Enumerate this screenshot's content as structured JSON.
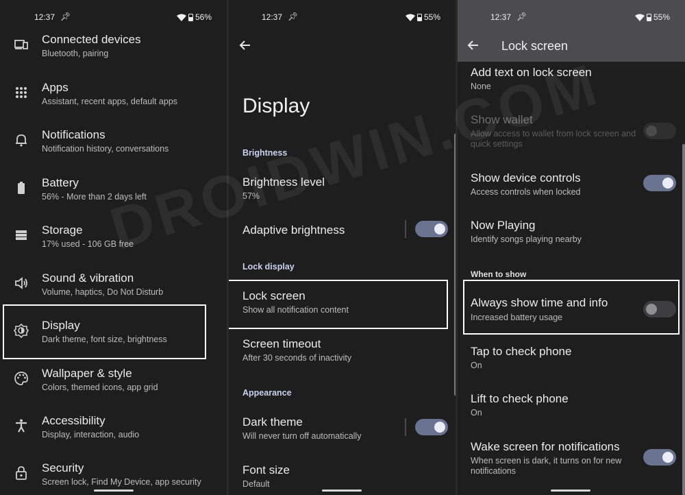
{
  "status": [
    {
      "time": "12:37",
      "battery": "56%"
    },
    {
      "time": "12:37",
      "battery": "55%"
    },
    {
      "time": "12:37",
      "battery": "55%"
    }
  ],
  "settings": {
    "items": [
      {
        "title": "Connected devices",
        "sub": "Bluetooth, pairing",
        "icon": "devices-icon"
      },
      {
        "title": "Apps",
        "sub": "Assistant, recent apps, default apps",
        "icon": "apps-grid-icon"
      },
      {
        "title": "Notifications",
        "sub": "Notification history, conversations",
        "icon": "bell-icon"
      },
      {
        "title": "Battery",
        "sub": "56% - More than 2 days left",
        "icon": "battery-icon"
      },
      {
        "title": "Storage",
        "sub": "17% used - 106 GB free",
        "icon": "storage-icon"
      },
      {
        "title": "Sound & vibration",
        "sub": "Volume, haptics, Do Not Disturb",
        "icon": "speaker-icon"
      },
      {
        "title": "Display",
        "sub": "Dark theme, font size, brightness",
        "icon": "display-brightness-icon"
      },
      {
        "title": "Wallpaper & style",
        "sub": "Colors, themed icons, app grid",
        "icon": "palette-icon"
      },
      {
        "title": "Accessibility",
        "sub": "Display, interaction, audio",
        "icon": "accessibility-icon"
      },
      {
        "title": "Security",
        "sub": "Screen lock, Find My Device, app security",
        "icon": "lock-icon"
      }
    ]
  },
  "display": {
    "page_title": "Display",
    "sections": {
      "brightness": "Brightness",
      "lock_display": "Lock display",
      "appearance": "Appearance"
    },
    "brightness_level": {
      "title": "Brightness level",
      "sub": "57%"
    },
    "adaptive_brightness": {
      "title": "Adaptive brightness",
      "on": true
    },
    "lock_screen": {
      "title": "Lock screen",
      "sub": "Show all notification content"
    },
    "screen_timeout": {
      "title": "Screen timeout",
      "sub": "After 30 seconds of inactivity"
    },
    "dark_theme": {
      "title": "Dark theme",
      "sub": "Will never turn off automatically",
      "on": true
    },
    "font_size": {
      "title": "Font size",
      "sub": "Default"
    }
  },
  "lockscreen": {
    "app_title": "Lock screen",
    "add_text": {
      "title": "Add text on lock screen",
      "sub": "None"
    },
    "show_wallet": {
      "title": "Show wallet",
      "sub1": "Allow access to wallet from lock screen and",
      "sub2": "quick settings",
      "disabled": true
    },
    "device_controls": {
      "title": "Show device controls",
      "sub": "Access controls when locked",
      "on": true
    },
    "now_playing": {
      "title": "Now Playing",
      "sub": "Identify songs playing nearby"
    },
    "section_when": "When to show",
    "always_show": {
      "title": "Always show time and info",
      "sub": "Increased battery usage",
      "on": false
    },
    "tap_check": {
      "title": "Tap to check phone",
      "sub": "On"
    },
    "lift_check": {
      "title": "Lift to check phone",
      "sub": "On"
    },
    "wake_screen": {
      "title": "Wake screen for notifications",
      "sub1": "When screen is dark, it turns on for new",
      "sub2": "notifications",
      "on": true
    }
  },
  "watermark": "DROIDWIN.COM",
  "colors": {
    "background": "#1e1e1f",
    "accent_section": "#c9d2ef",
    "toggle_on": "#6a7390",
    "highlight": "#ffffff"
  }
}
